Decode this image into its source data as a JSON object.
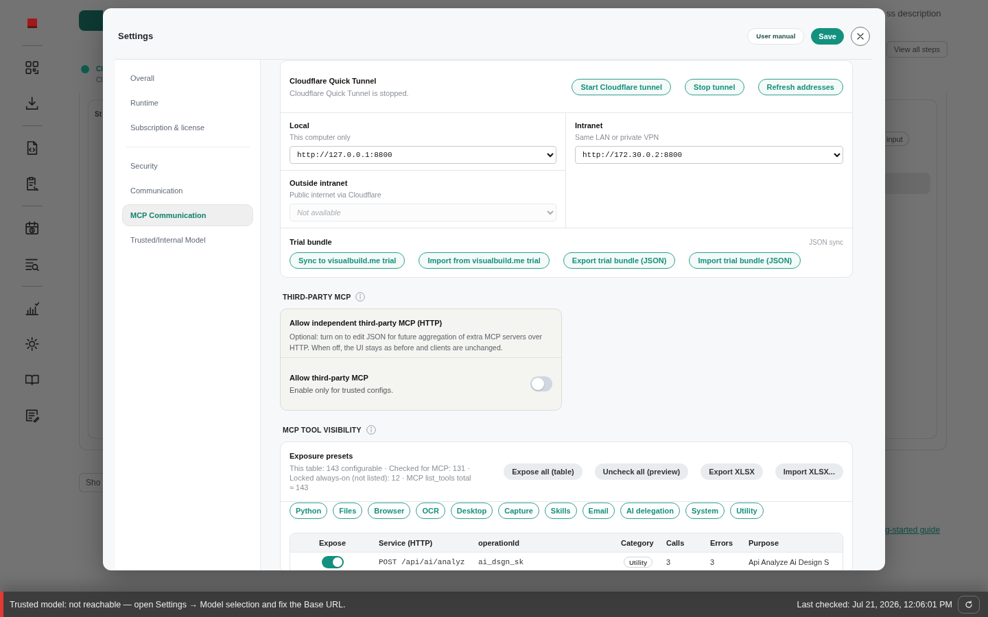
{
  "background": {
    "header_note": "ss description",
    "steps_button": "View all steps",
    "status": {
      "title": "Cl",
      "subtitle": "Cl"
    },
    "panel": {
      "title": "St",
      "chip": "input"
    },
    "show_button": "Sho",
    "guide_link": "g-started guide"
  },
  "settings": {
    "title": "Settings",
    "actions": [
      {
        "label": "User manual",
        "kind": "secondary"
      },
      {
        "label": "Save",
        "kind": "primary"
      }
    ],
    "nav": [
      [
        {
          "label": "Overall",
          "selected": false
        },
        {
          "label": "Runtime",
          "selected": false
        },
        {
          "label": "Subscription & license",
          "selected": false
        }
      ],
      [
        {
          "label": "Security",
          "selected": false
        },
        {
          "label": "Communication",
          "selected": false
        },
        {
          "label": "MCP Communication",
          "selected": true
        },
        {
          "label": "Trusted/Internal Model",
          "selected": false
        }
      ]
    ],
    "tunnel": {
      "title": "Cloudflare Quick Tunnel",
      "status": "Cloudflare Quick Tunnel is stopped.",
      "buttons": [
        "Start Cloudflare tunnel",
        "Stop tunnel",
        "Refresh addresses"
      ]
    },
    "addresses": [
      [
        {
          "title": "Local",
          "hint": "This computer only",
          "value": "http://127.0.0.1:8800",
          "disabled": false
        },
        {
          "title": "Outside intranet",
          "hint": "Public internet via Cloudflare",
          "placeholder": "Not available",
          "disabled": true
        }
      ],
      [
        {
          "title": "Intranet",
          "hint": "Same LAN or private VPN",
          "value": "http://172.30.0.2:8800",
          "disabled": false
        }
      ]
    ],
    "trial_bundle": {
      "title": "Trial bundle",
      "note": "JSON sync",
      "buttons": [
        "Sync to visualbuild.me trial",
        "Import from visualbuild.me trial",
        "Export trial bundle (JSON)",
        "Import trial bundle (JSON)"
      ]
    },
    "third_party": {
      "heading": "THIRD-PARTY MCP",
      "rows": [
        {
          "kind": "info",
          "title": "Allow independent third-party MCP (HTTP)",
          "description": "Optional: turn on to edit JSON for future aggregation of extra MCP servers over HTTP. When off, the UI stays as before and clients are unchanged."
        },
        {
          "kind": "toggle",
          "title": "Allow third-party MCP",
          "description": "Enable only for trusted configs.",
          "on": false
        }
      ]
    },
    "tool_visibility": {
      "heading": "MCP TOOL VISIBILITY",
      "presets": {
        "title": "Exposure presets",
        "description": "This table: 143 configurable · Checked for MCP: 131 · Locked always-on (not listed): 12 · MCP list_tools total ≈ 143",
        "buttons": [
          "Expose all (table)",
          "Uncheck all (preview)",
          "Export XLSX",
          "Import XLSX..."
        ]
      },
      "categories": [
        "Python",
        "Files",
        "Browser",
        "OCR",
        "Desktop",
        "Capture",
        "Skills",
        "Email",
        "AI delegation",
        "System",
        "Utility"
      ],
      "table": {
        "columns": [
          "Expose",
          "Service (HTTP)",
          "operationId",
          "Category",
          "Calls",
          "Errors",
          "Purpose"
        ],
        "rows": [
          {
            "expose": true,
            "service": "POST /api/ai/analyz",
            "operation_id": "ai_dsgn_sk",
            "category": "Utility",
            "calls": "3",
            "errors": "3",
            "purpose": "Api Analyze Ai Design S"
          }
        ]
      }
    }
  },
  "status_bar": {
    "kind": "error",
    "message": "Trusted model: not reachable — open Settings → Model selection and fix the Base URL.",
    "last_checked": "Last checked: Jul 21, 2026, 12:06:01 PM"
  }
}
